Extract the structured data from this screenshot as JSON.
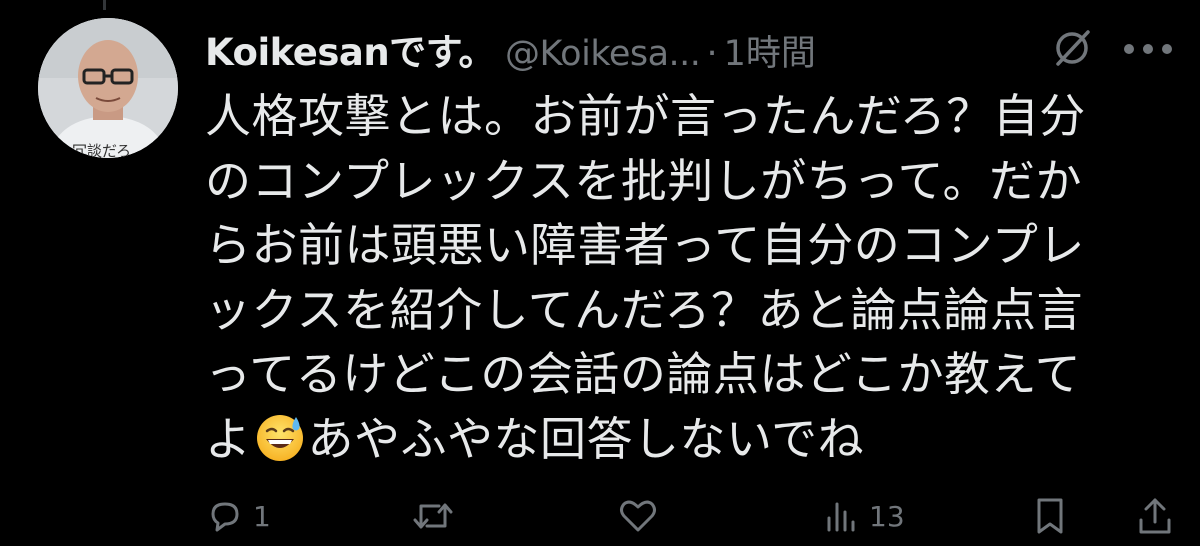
{
  "tweet": {
    "author": {
      "display_name": "Koikesanです。",
      "handle": "@Koikesa...",
      "avatar_caption": "冗談だろ"
    },
    "separator": "·",
    "time": "1時間",
    "text_lines": [
      "人格攻撃とは。お前が言ったんだろ？自分",
      "のコンプレックスを批判しがちって。だか",
      "らお前は頭悪い障害者って自分のコンプレ",
      "ックスを紹介してんだろ？あと論点論点言",
      "ってるけどこの会話の論点はどこか教えて"
    ],
    "last_line_prefix": "よ",
    "last_line_emoji": "grinning-face-with-sweat-emoji",
    "last_line_suffix": "あやふやな回答しないでね"
  },
  "actions": {
    "reply_count": "1",
    "retweet_count": "",
    "like_count": "",
    "views_count": "13",
    "icons": [
      "reply-icon",
      "retweet-icon",
      "like-icon",
      "views-icon",
      "bookmark-icon",
      "share-icon"
    ]
  },
  "colors": {
    "background": "#000000",
    "text_primary": "#e7e9ea",
    "text_secondary": "#71767b",
    "thread_line": "#333639"
  }
}
